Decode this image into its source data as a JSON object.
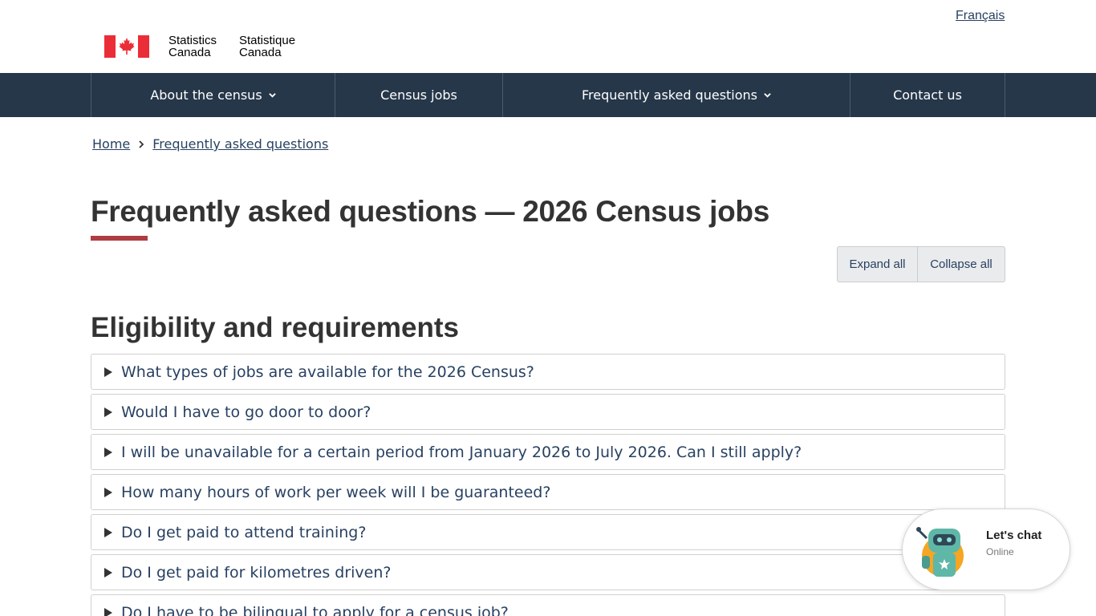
{
  "header": {
    "language_link": "Français",
    "brand_en_line1": "Statistics",
    "brand_en_line2": "Canada",
    "brand_fr_line1": "Statistique",
    "brand_fr_line2": "Canada"
  },
  "nav": {
    "items": [
      {
        "label": "About the census",
        "has_dropdown": true
      },
      {
        "label": "Census jobs",
        "has_dropdown": false
      },
      {
        "label": "Frequently asked questions",
        "has_dropdown": true
      },
      {
        "label": "Contact us",
        "has_dropdown": false
      }
    ]
  },
  "breadcrumb": {
    "home": "Home",
    "current": "Frequently asked questions"
  },
  "main": {
    "title": "Frequently asked questions — 2026 Census jobs",
    "expand_all": "Expand all",
    "collapse_all": "Collapse all",
    "section_title": "Eligibility and requirements",
    "questions": [
      "What types of jobs are available for the 2026 Census?",
      "Would I have to go door to door?",
      "I will be unavailable for a certain period from January 2026 to July 2026. Can I still apply?",
      "How many hours of work per week will I be guaranteed?",
      "Do I get paid to attend training?",
      "Do I get paid for kilometres driven?",
      "Do I have to be bilingual to apply for a census job?"
    ]
  },
  "chat": {
    "title": "Let's chat",
    "status": "Online"
  },
  "colors": {
    "nav_bg": "#26374a",
    "link": "#284162",
    "accent_rule": "#af3c43",
    "flag_red": "#eb2d37"
  },
  "icons": {
    "flag": "canada-flag-icon",
    "dropdown": "chevron-down-icon",
    "breadcrumb_separator": "chevron-right-icon",
    "question_toggle": "triangle-right-icon",
    "chatbot": "robot-icon"
  }
}
